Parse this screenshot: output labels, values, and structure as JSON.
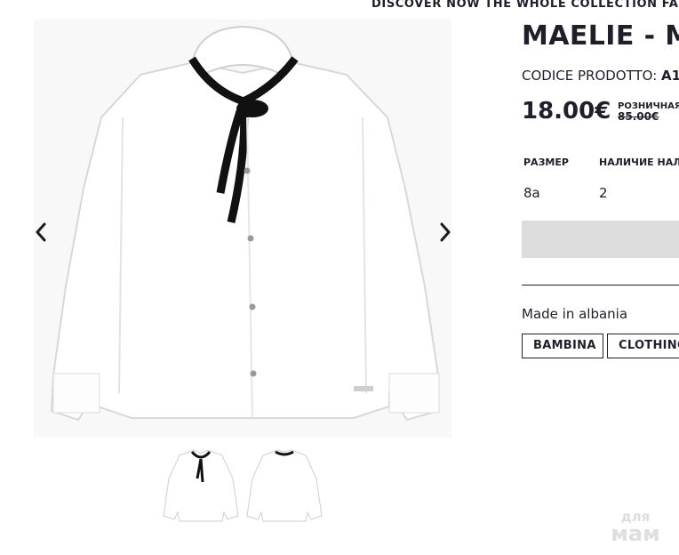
{
  "banner": {
    "text": "DISCOVER NOW THE WHOLE COLLECTION FALL/"
  },
  "product": {
    "title": "MAELIE - M",
    "code_label": "CODICE PRODOTTO:",
    "code_value": "A1",
    "price": "18.00€",
    "retail_label": "РОЗНИЧНАЯ",
    "retail_price": "85.00€"
  },
  "table": {
    "headers": [
      "РАЗМЕР",
      "НАЛИЧИЕ НАЛ"
    ],
    "row": [
      "8a",
      "2"
    ]
  },
  "details": {
    "made_in": "Made in albania"
  },
  "tags": [
    "BAMBINA",
    "CLOTHING"
  ],
  "watermark": {
    "line1": "для",
    "line2": "мам"
  },
  "colors": {
    "text": "#1f1f2a",
    "button": "#dcdcdc",
    "background": "#ffffff"
  },
  "icons": {
    "prev": "chevron-left-icon",
    "next": "chevron-right-icon"
  }
}
